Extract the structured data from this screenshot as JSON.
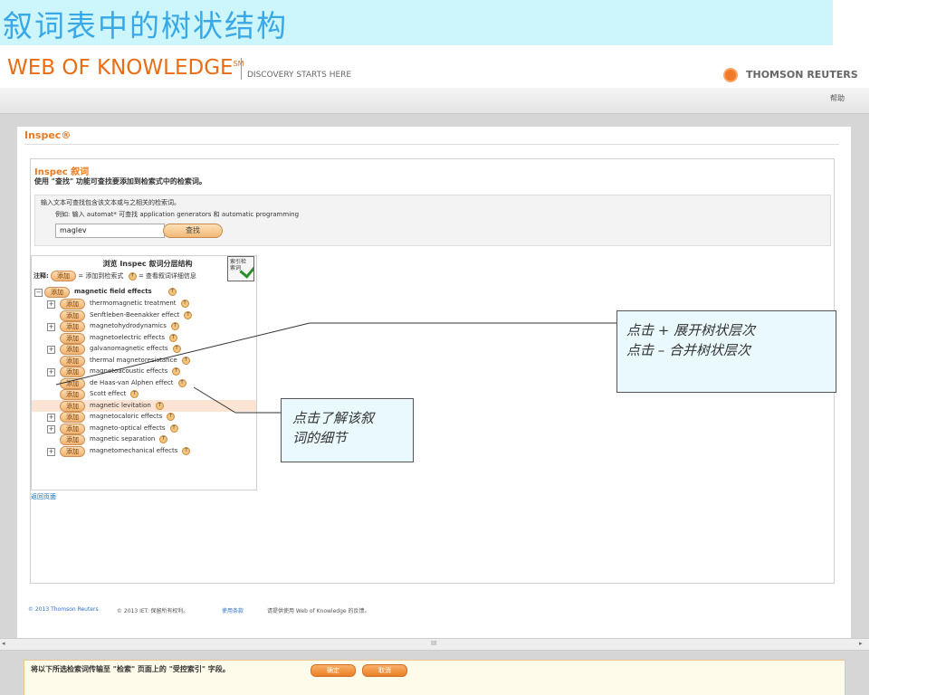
{
  "slide": {
    "title": "叙词表中的树状结构"
  },
  "header": {
    "brand": "WEB OF KNOWLEDGE",
    "brand_mark": "SM",
    "tagline": "DISCOVERY STARTS HERE",
    "publisher": "THOMSON REUTERS",
    "help_link": "帮助"
  },
  "page": {
    "product": "Inspec®",
    "panel_title": "Inspec 叙词",
    "panel_subtitle": "使用 \"查找\" 功能可查找要添加到检索式中的检索词。",
    "search": {
      "hint": "输入文本可查找包含该文本或与之相关的检索词。",
      "example": "例如: 输入 automat* 可查找 application generators 和 automatic programming",
      "value": "maglev",
      "button": "查找"
    },
    "tree": {
      "heading": "浏览 Inspec 叙词分层结构",
      "legend_prefix": "注释:",
      "legend_add": "添加",
      "legend_add_text": "= 添加到检索式",
      "legend_t": "T",
      "legend_t_text": "= 查看叙词详细信息",
      "index_icon_label": "索引检索词",
      "add_label": "添加",
      "t_label": "T",
      "expand_label": "+",
      "collapse_label": "−",
      "root": "magnetic field effects",
      "items": [
        {
          "label": "thermomagnetic treatment"
        },
        {
          "label": "Senftleben-Beenakker effect"
        },
        {
          "label": "magnetohydrodynamics"
        },
        {
          "label": "magnetoelectric effects"
        },
        {
          "label": "galvanomagnetic effects"
        },
        {
          "label": "thermal magnetoresistance"
        },
        {
          "label": "magnetoacoustic effects"
        },
        {
          "label": "de Haas-van Alphen effect"
        },
        {
          "label": "Scott effect"
        },
        {
          "label": "magnetic levitation"
        },
        {
          "label": "magnetocaloric effects"
        },
        {
          "label": "magneto-optical effects"
        },
        {
          "label": "magnetic separation"
        },
        {
          "label": "magnetomechanical effects"
        }
      ]
    },
    "back_link": "返回页面"
  },
  "footer": {
    "copyright": "© 2013 Thomson Reuters",
    "et": "© 2013 IET. 保留所有权利。",
    "terms": "使用条款",
    "feedback": "请提供使用 Web of Knowledge 的反馈。"
  },
  "scrollbar": {
    "left": "◂",
    "right": "▸",
    "grip": "III"
  },
  "bottom_bar": {
    "text": "将以下所选检索词传输至 \"检索\" 页面上的 \"受控索引\" 字段。",
    "ok": "确定",
    "cancel": "取消"
  },
  "annotations": {
    "expand_line1": "点击 + 展开树状层次",
    "expand_line2": "点击 – 合并树状层次",
    "detail_line1": "点击了解该叙",
    "detail_line2": "词的细节"
  },
  "colors": {
    "title_bar": "#ccf6fb",
    "title_text": "#3aa7e6",
    "brand_orange": "#ea6c13",
    "selected_row": "#fbe4d3",
    "callout_bg": "#eaf9fd"
  }
}
